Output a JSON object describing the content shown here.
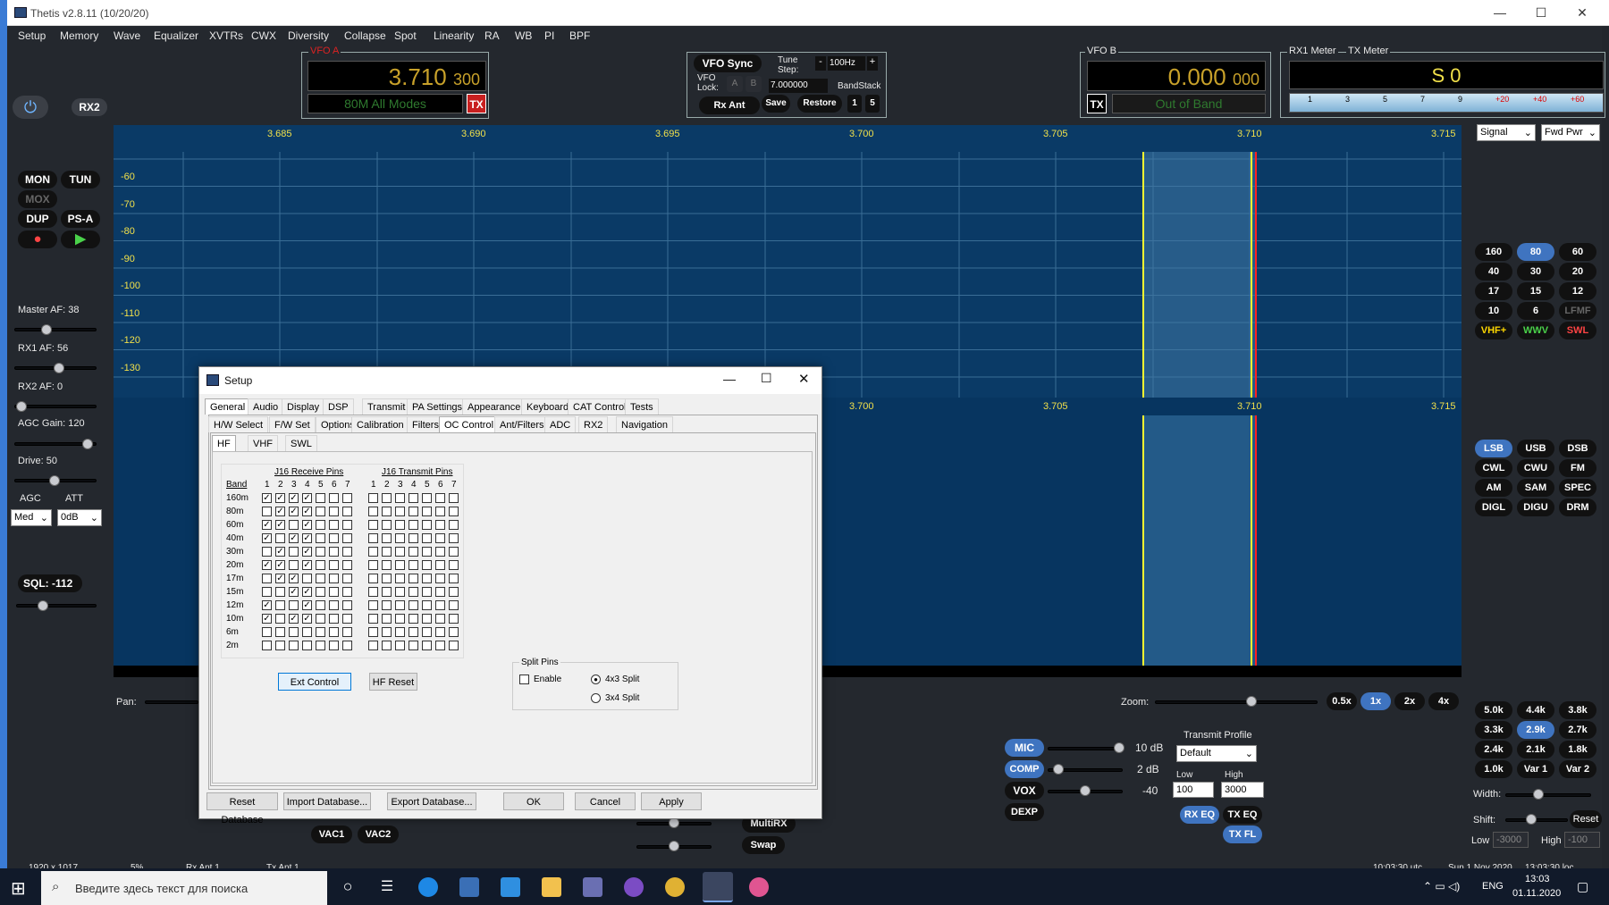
{
  "window": {
    "title": "Thetis v2.8.11 (10/20/20)"
  },
  "menu": [
    "Setup",
    "Memory",
    "Wave",
    "Equalizer",
    "XVTRs",
    "CWX",
    "Diversity",
    "Collapse",
    "Spot",
    "Linearity",
    "RA",
    "WB",
    "PI",
    "BPF"
  ],
  "left": {
    "rx2": "RX2",
    "mon": "MON",
    "tun": "TUN",
    "mox": "MOX",
    "dup": "DUP",
    "psa": "PS-A",
    "master_af": "Master AF:  38",
    "rx1_af": "RX1 AF:  56",
    "rx2_af": "RX2 AF:  0",
    "agc_gain": "AGC Gain:  120",
    "drive": "Drive:  50",
    "agc": "AGC",
    "att": "ATT",
    "agc_val": "Med",
    "att_val": "0dB",
    "sql": "SQL: -112"
  },
  "vfo_a": {
    "label": "VFO A",
    "freq": "3.710",
    "sub": "300",
    "band": "80M All Modes",
    "tx": "TX"
  },
  "vfo_mid": {
    "vfo_sync": "VFO Sync",
    "tune_step": "Tune Step:",
    "step_val": "100Hz",
    "vfo_lock": "VFO Lock:",
    "a": "A",
    "b": "B",
    "freq": "7.000000",
    "bandstack": "BandStack",
    "rx_ant": "Rx Ant",
    "save": "Save",
    "restore": "Restore",
    "one": "1",
    "five": "5"
  },
  "vfo_b": {
    "label": "VFO B",
    "freq": "0.000",
    "sub": "000",
    "tx": "TX",
    "band": "Out of Band"
  },
  "meter": {
    "rx1": "RX1 Meter",
    "tx": "TX Meter",
    "value": "S 0",
    "scale": [
      "1",
      "3",
      "5",
      "7",
      "9",
      "+20",
      "+40",
      "+60"
    ],
    "sig": "Signal",
    "fwd": "Fwd Pwr"
  },
  "spectrum": {
    "freqs": [
      "3.685",
      "3.690",
      "3.695",
      "3.700",
      "3.705",
      "3.710",
      "3.715"
    ],
    "db": [
      "-60",
      "-70",
      "-80",
      "-90",
      "-100",
      "-110",
      "-120",
      "-130"
    ],
    "wf_freqs": [
      "3.700",
      "3.705",
      "3.710",
      "3.715"
    ]
  },
  "bands": [
    "160",
    "80",
    "60",
    "40",
    "30",
    "20",
    "17",
    "15",
    "12",
    "10",
    "6",
    "LFMF",
    "VHF+",
    "WWV",
    "SWL"
  ],
  "modes": [
    "LSB",
    "USB",
    "DSB",
    "CWL",
    "CWU",
    "FM",
    "AM",
    "SAM",
    "SPEC",
    "DIGL",
    "DIGU",
    "DRM"
  ],
  "filters": [
    "5.0k",
    "4.4k",
    "3.8k",
    "3.3k",
    "2.9k",
    "2.7k",
    "2.4k",
    "2.1k",
    "1.8k",
    "1.0k",
    "Var 1",
    "Var 2"
  ],
  "filter_ctrl": {
    "width": "Width:",
    "shift": "Shift:",
    "reset": "Reset",
    "low": "Low",
    "high": "High",
    "low_val": "-3000",
    "high_val": "-100"
  },
  "zoom": {
    "pan": "Pan:",
    "zoom": "Zoom:",
    "opts": [
      "0.5x",
      "1x",
      "2x",
      "4x"
    ]
  },
  "tx": {
    "mic": "MIC",
    "mic_val": "10 dB",
    "comp": "COMP",
    "comp_val": "2 dB",
    "vox": "VOX",
    "vox_val": "-40",
    "dexp": "DEXP",
    "profile_lbl": "Transmit Profile",
    "profile": "Default",
    "low": "Low",
    "high": "High",
    "low_val": "100",
    "high_val": "3000",
    "rxeq": "RX EQ",
    "txeq": "TX EQ",
    "txfl": "TX FL"
  },
  "bottom": {
    "vac1": "VAC1",
    "vac2": "VAC2",
    "multirx": "MultiRX",
    "swap": "Swap",
    "res": "1920 x 1017",
    "pct": "5%",
    "rxant": "Rx Ant 1",
    "txant": "Tx Ant 1",
    "utc": "10:03:30 utc",
    "date": "Sun 1 Nov 2020",
    "loc": "13:03:30 loc"
  },
  "setup": {
    "title": "Setup",
    "tabs": [
      "General",
      "Audio",
      "Display",
      "DSP",
      "Transmit",
      "PA Settings",
      "Appearance",
      "Keyboard",
      "CAT Control",
      "Tests"
    ],
    "subtabs": [
      "H/W Select",
      "F/W Set",
      "Options",
      "Calibration",
      "Filters",
      "OC Control",
      "Ant/Filters",
      "ADC",
      "RX2",
      "Navigation"
    ],
    "hftabs": [
      "HF",
      "VHF",
      "SWL"
    ],
    "rx_pins": "J16 Receive Pins",
    "tx_pins": "J16 Transmit Pins",
    "band_hdr": "Band",
    "pins": [
      "1",
      "2",
      "3",
      "4",
      "5",
      "6",
      "7"
    ],
    "bands": [
      "160m",
      "80m",
      "60m",
      "40m",
      "30m",
      "20m",
      "17m",
      "15m",
      "12m",
      "10m",
      "6m",
      "2m"
    ],
    "rx_checks": [
      [
        1,
        1,
        1,
        1,
        0,
        0,
        0
      ],
      [
        0,
        1,
        1,
        1,
        0,
        0,
        0
      ],
      [
        1,
        1,
        0,
        1,
        0,
        0,
        0
      ],
      [
        1,
        0,
        1,
        1,
        0,
        0,
        0
      ],
      [
        0,
        1,
        0,
        1,
        0,
        0,
        0
      ],
      [
        1,
        1,
        0,
        1,
        0,
        0,
        0
      ],
      [
        0,
        1,
        1,
        0,
        0,
        0,
        0
      ],
      [
        0,
        0,
        1,
        1,
        0,
        0,
        0
      ],
      [
        1,
        0,
        0,
        1,
        0,
        0,
        0
      ],
      [
        1,
        0,
        1,
        1,
        0,
        0,
        0
      ],
      [
        0,
        0,
        0,
        0,
        0,
        0,
        0
      ],
      [
        0,
        0,
        0,
        0,
        0,
        0,
        0
      ]
    ],
    "ext_control": "Ext Control",
    "hf_reset": "HF Reset",
    "split_pins": "Split Pins",
    "enable": "Enable",
    "split43": "4x3 Split",
    "split34": "3x4 Split",
    "reset_db": "Reset Database",
    "import_db": "Import Database...",
    "export_db": "Export Database...",
    "ok": "OK",
    "cancel": "Cancel",
    "apply": "Apply"
  },
  "taskbar": {
    "search": "Введите здесь текст для поиска",
    "lang": "ENG",
    "time": "13:03",
    "date": "01.11.2020"
  }
}
